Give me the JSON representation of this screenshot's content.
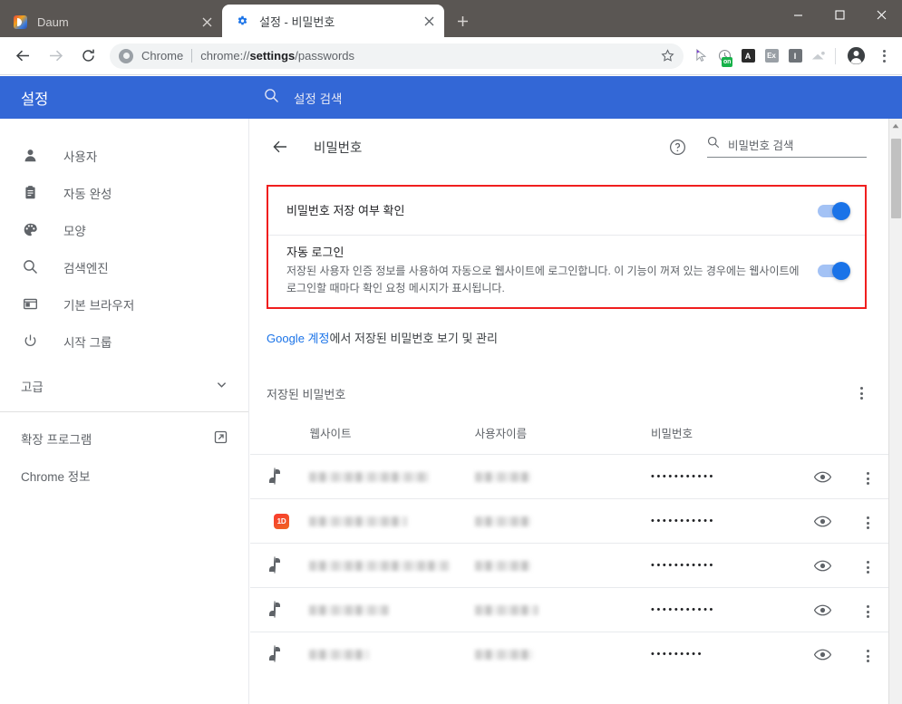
{
  "window": {
    "minimize_label": "최소화",
    "maximize_label": "최대화",
    "close_label": "닫기"
  },
  "tabs": [
    {
      "title": "Daum",
      "favicon": "daum-logo-icon",
      "active": false,
      "close_label": "탭 닫기"
    },
    {
      "title": "설정 - 비밀번호",
      "favicon": "settings-gear-icon",
      "active": true,
      "close_label": "탭 닫기"
    }
  ],
  "new_tab_label": "새 탭",
  "toolbar": {
    "back_label": "뒤로",
    "forward_label": "앞으로",
    "reload_label": "새로고침",
    "omnibox": {
      "security_icon": "chrome-logo-icon",
      "scheme_label": "Chrome",
      "url_prefix": "chrome://",
      "url_bold": "settings",
      "url_suffix": "/passwords"
    },
    "bookmark_label": "북마크",
    "extensions": [
      {
        "name": "cursor-extension-icon",
        "label": "",
        "badge": ""
      },
      {
        "name": "clock-extension-icon",
        "label": "",
        "badge": "on"
      },
      {
        "name": "letter-a-extension-icon",
        "label": "A",
        "badge": ""
      },
      {
        "name": "ex-extension-icon",
        "label": "Ex",
        "badge": ""
      },
      {
        "name": "letter-i-extension-icon",
        "label": "I",
        "badge": ""
      },
      {
        "name": "envelope-extension-icon",
        "label": "",
        "badge": ""
      }
    ],
    "profile_label": "프로필",
    "menu_label": "Chrome 맞춤설정 및 제어"
  },
  "settings_header": {
    "brand": "설정",
    "search_placeholder": "설정 검색",
    "search_icon": "search-icon"
  },
  "sidebar": {
    "items": [
      {
        "label": "사용자",
        "icon": "person-icon"
      },
      {
        "label": "자동 완성",
        "icon": "clipboard-icon"
      },
      {
        "label": "모양",
        "icon": "palette-icon"
      },
      {
        "label": "검색엔진",
        "icon": "search-icon"
      },
      {
        "label": "기본 브라우저",
        "icon": "browser-window-icon"
      },
      {
        "label": "시작 그룹",
        "icon": "power-icon"
      }
    ],
    "advanced": {
      "label": "고급",
      "icon": "chevron-down-icon"
    },
    "footer": [
      {
        "label": "확장 프로그램",
        "icon": "external-link-icon"
      },
      {
        "label": "Chrome 정보",
        "icon": ""
      }
    ]
  },
  "page": {
    "back_label": "뒤로",
    "title": "비밀번호",
    "help_label": "도움말",
    "search_placeholder": "비밀번호 검색",
    "search_icon": "search-icon"
  },
  "prefs": [
    {
      "title": "비밀번호 저장 여부 확인",
      "desc": "",
      "toggle_on": true
    },
    {
      "title": "자동 로그인",
      "desc": "저장된 사용자 인증 정보를 사용하여 자동으로 웹사이트에 로그인합니다. 이 기능이 꺼져 있는 경우에는 웹사이트에 로그인할 때마다 확인 요청 메시지가 표시됩니다.",
      "toggle_on": true
    }
  ],
  "google_account_line": {
    "link_text": "Google 계정",
    "rest_text": "에서 저장된 비밀번호 보기 및 관리"
  },
  "saved_section": {
    "title": "저장된 비밀번호",
    "menu_label": "추가 작업",
    "columns": [
      "웹사이트",
      "사용자이름",
      "비밀번호"
    ],
    "rows": [
      {
        "favicon": "globe-icon",
        "site": "",
        "username": "",
        "password_dots": "•••••••••••",
        "eye_label": "비밀번호 표시",
        "more_label": "추가 작업"
      },
      {
        "favicon": "1d-favicon",
        "site": "",
        "username": "",
        "password_dots": "•••••••••••",
        "eye_label": "비밀번호 표시",
        "more_label": "추가 작업"
      },
      {
        "favicon": "globe-icon",
        "site": "",
        "username": "",
        "password_dots": "•••••••••••",
        "eye_label": "비밀번호 표시",
        "more_label": "추가 작업"
      },
      {
        "favicon": "globe-icon",
        "site": "",
        "username": "",
        "password_dots": "•••••••••••",
        "eye_label": "비밀번호 표시",
        "more_label": "추가 작업"
      },
      {
        "favicon": "globe-icon",
        "site": "",
        "username": "",
        "password_dots": "•••••••••",
        "eye_label": "비밀번호 표시",
        "more_label": "추가 작업"
      }
    ]
  },
  "colors": {
    "settings_blue": "#3367d6",
    "link_blue": "#1a73e8",
    "toggle_blue": "#1a73e8",
    "highlight_red": "#f01e1e",
    "tabstrip": "#5a5653"
  },
  "scrollbar": {
    "label": "스크롤바"
  }
}
